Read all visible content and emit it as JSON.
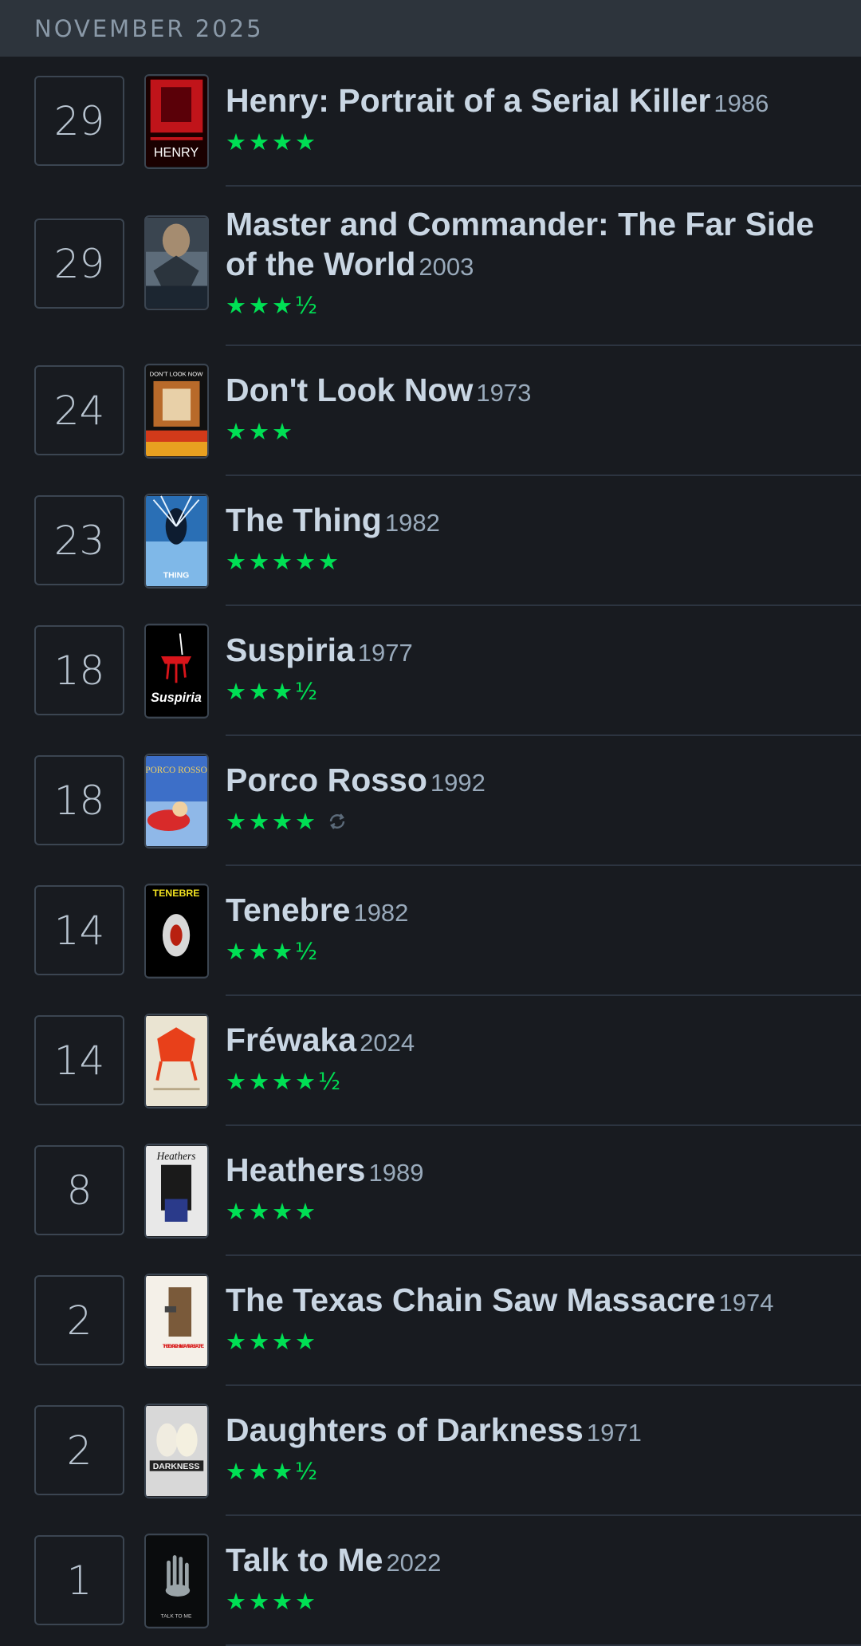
{
  "header": {
    "month": "NOVEMBER 2025"
  },
  "entries": [
    {
      "day": "29",
      "title": "Henry: Portrait of a Serial Killer",
      "year": "1986",
      "stars": "★★★★",
      "rewatch": false,
      "poster": "poster-henry",
      "poster_text": "HENRY"
    },
    {
      "day": "29",
      "title": "Master and Commander: The Far Side of the World",
      "year": "2003",
      "stars": "★★★½",
      "rewatch": false,
      "poster": "poster-master-commander",
      "poster_text": ""
    },
    {
      "day": "24",
      "title": "Don't Look Now",
      "year": "1973",
      "stars": "★★★",
      "rewatch": false,
      "poster": "poster-dont-look-now",
      "poster_text": "DON'T LOOK NOW"
    },
    {
      "day": "23",
      "title": "The Thing",
      "year": "1982",
      "stars": "★★★★★",
      "rewatch": false,
      "poster": "poster-the-thing",
      "poster_text": "THING"
    },
    {
      "day": "18",
      "title": "Suspiria",
      "year": "1977",
      "stars": "★★★½",
      "rewatch": false,
      "poster": "poster-suspiria",
      "poster_text": "Suspiria"
    },
    {
      "day": "18",
      "title": "Porco Rosso",
      "year": "1992",
      "stars": "★★★★",
      "rewatch": true,
      "poster": "poster-porco-rosso",
      "poster_text": "PORCO ROSSO"
    },
    {
      "day": "14",
      "title": "Tenebre",
      "year": "1982",
      "stars": "★★★½",
      "rewatch": false,
      "poster": "poster-tenebre",
      "poster_text": "TENEBRE"
    },
    {
      "day": "14",
      "title": "Fréwaka",
      "year": "2024",
      "stars": "★★★★½",
      "rewatch": false,
      "poster": "poster-frewaka",
      "poster_text": ""
    },
    {
      "day": "8",
      "title": "Heathers",
      "year": "1989",
      "stars": "★★★★",
      "rewatch": false,
      "poster": "poster-heathers",
      "poster_text": "Heathers"
    },
    {
      "day": "2",
      "title": "The Texas Chain Saw Massacre",
      "year": "1974",
      "stars": "★★★★",
      "rewatch": false,
      "poster": "poster-texas-chain-saw",
      "poster_text": "THE TEXAS CHAINSAW MASSACRE"
    },
    {
      "day": "2",
      "title": "Daughters of Darkness",
      "year": "1971",
      "stars": "★★★½",
      "rewatch": false,
      "poster": "poster-daughters-of-darkness",
      "poster_text": "DARKNESS"
    },
    {
      "day": "1",
      "title": "Talk to Me",
      "year": "2022",
      "stars": "★★★★",
      "rewatch": false,
      "poster": "poster-talk-to-me",
      "poster_text": "TALK TO ME"
    }
  ],
  "colors": {
    "star": "#00e054",
    "background": "#181b20",
    "header_bg": "#2d343c"
  }
}
